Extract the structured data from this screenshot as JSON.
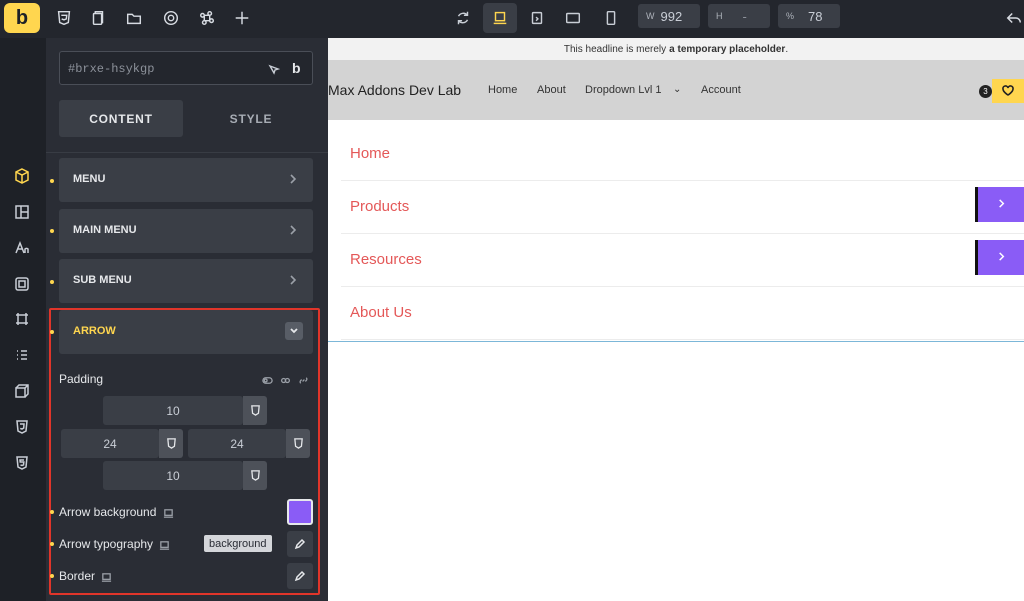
{
  "topbar": {
    "logo_letter": "b",
    "width_label": "W",
    "width_value": "992",
    "height_label": "H",
    "height_value": "-",
    "zoom_label": "%",
    "zoom_value": "78"
  },
  "panel": {
    "selector_text": "#brxe-hsykgp",
    "selector_b": "b",
    "tab_content": "CONTENT",
    "tab_style": "STYLE",
    "accordions": [
      "MENU",
      "MAIN MENU",
      "SUB MENU"
    ],
    "active_accordion": "ARROW",
    "padding_label": "Padding",
    "padding": {
      "top": "10",
      "right": "24",
      "left": "24",
      "bottom": "10"
    },
    "arrow_background_label": "Arrow background",
    "arrow_background_color": "#8a5cf6",
    "arrow_typography_label": "Arrow typography",
    "border_label": "Border",
    "tooltip": "background"
  },
  "canvas": {
    "notice_prefix": "This headline is merely",
    "notice_bold": "a temporary placeholder",
    "notice_suffix": ".",
    "site_title": "Max Addons Dev Lab",
    "nav": [
      "Home",
      "About",
      "Dropdown Lvl 1",
      "Account"
    ],
    "badge_count": "3",
    "menu_items": [
      "Home",
      "Products",
      "Resources",
      "About Us"
    ],
    "accent_color": "#e45858",
    "brand_color": "#ffd64f"
  }
}
